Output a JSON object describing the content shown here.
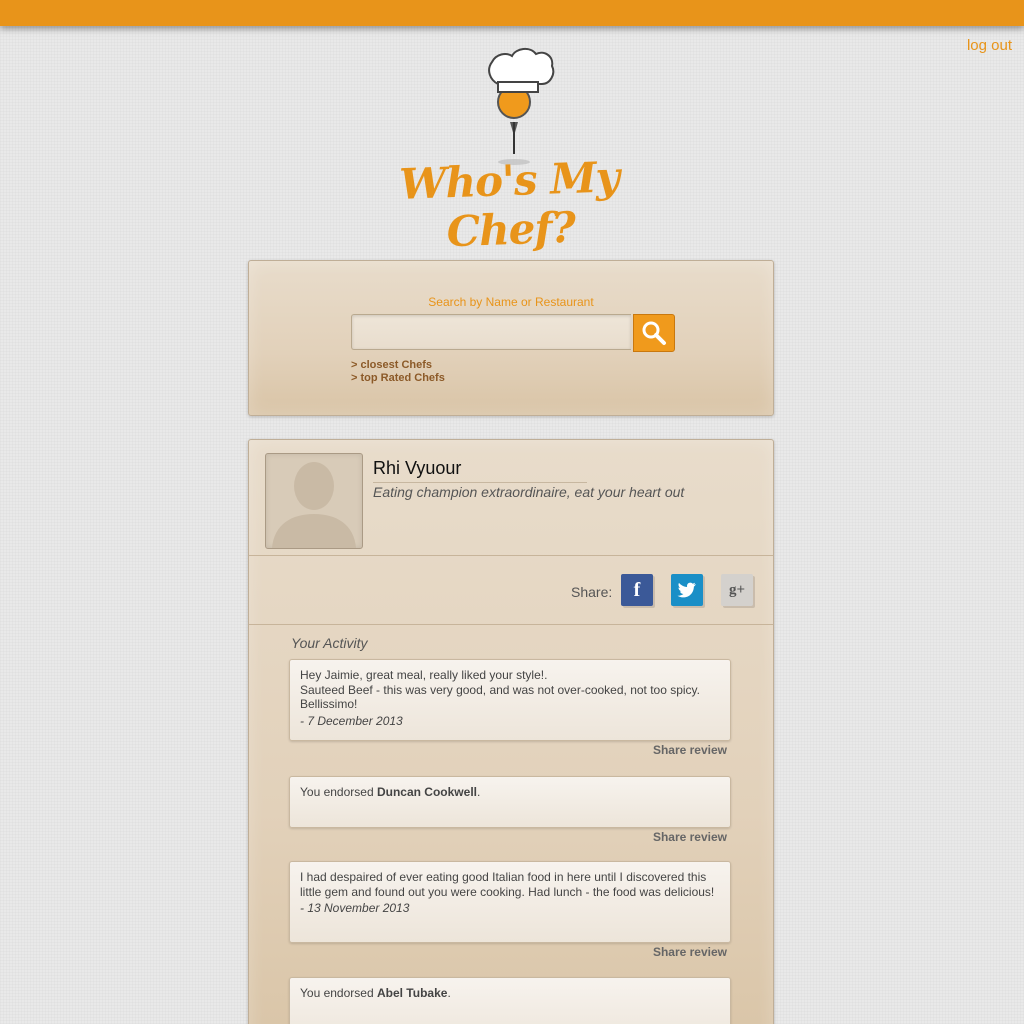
{
  "header": {
    "logout_label": "log out",
    "brand": "Who's My Chef?"
  },
  "search": {
    "label": "Search by Name or Restaurant",
    "placeholder": "",
    "links": [
      "> closest Chefs",
      "> top Rated Chefs"
    ]
  },
  "profile": {
    "name": "Rhi Vyuour",
    "tagline": "Eating champion extraordinaire, eat your heart out"
  },
  "share": {
    "label": "Share:",
    "facebook": "f",
    "google": "g+"
  },
  "activity": {
    "title": "Your Activity",
    "share_review_label": "Share review",
    "items": [
      {
        "line1": "Hey Jaimie, great meal, really liked your style!.",
        "line2": "Sauteed Beef - this was very good, and was not over-cooked, not too spicy. Bellissimo!",
        "date": "- 7 December 2013"
      },
      {
        "prefix": "You endorsed ",
        "name": "Duncan Cookwell",
        "suffix": "."
      },
      {
        "text": "I had despaired of ever eating good Italian food in here until I discovered this little gem and found out you were cooking. Had lunch - the food was delicious!",
        "date": "- 13 November 2013"
      },
      {
        "prefix": "You endorsed ",
        "name": "Abel Tubake",
        "suffix": "."
      }
    ]
  },
  "colors": {
    "accent": "#e8941a",
    "facebook": "#3b5998",
    "twitter": "#1a8fc7",
    "google": "#d4d1cd"
  }
}
